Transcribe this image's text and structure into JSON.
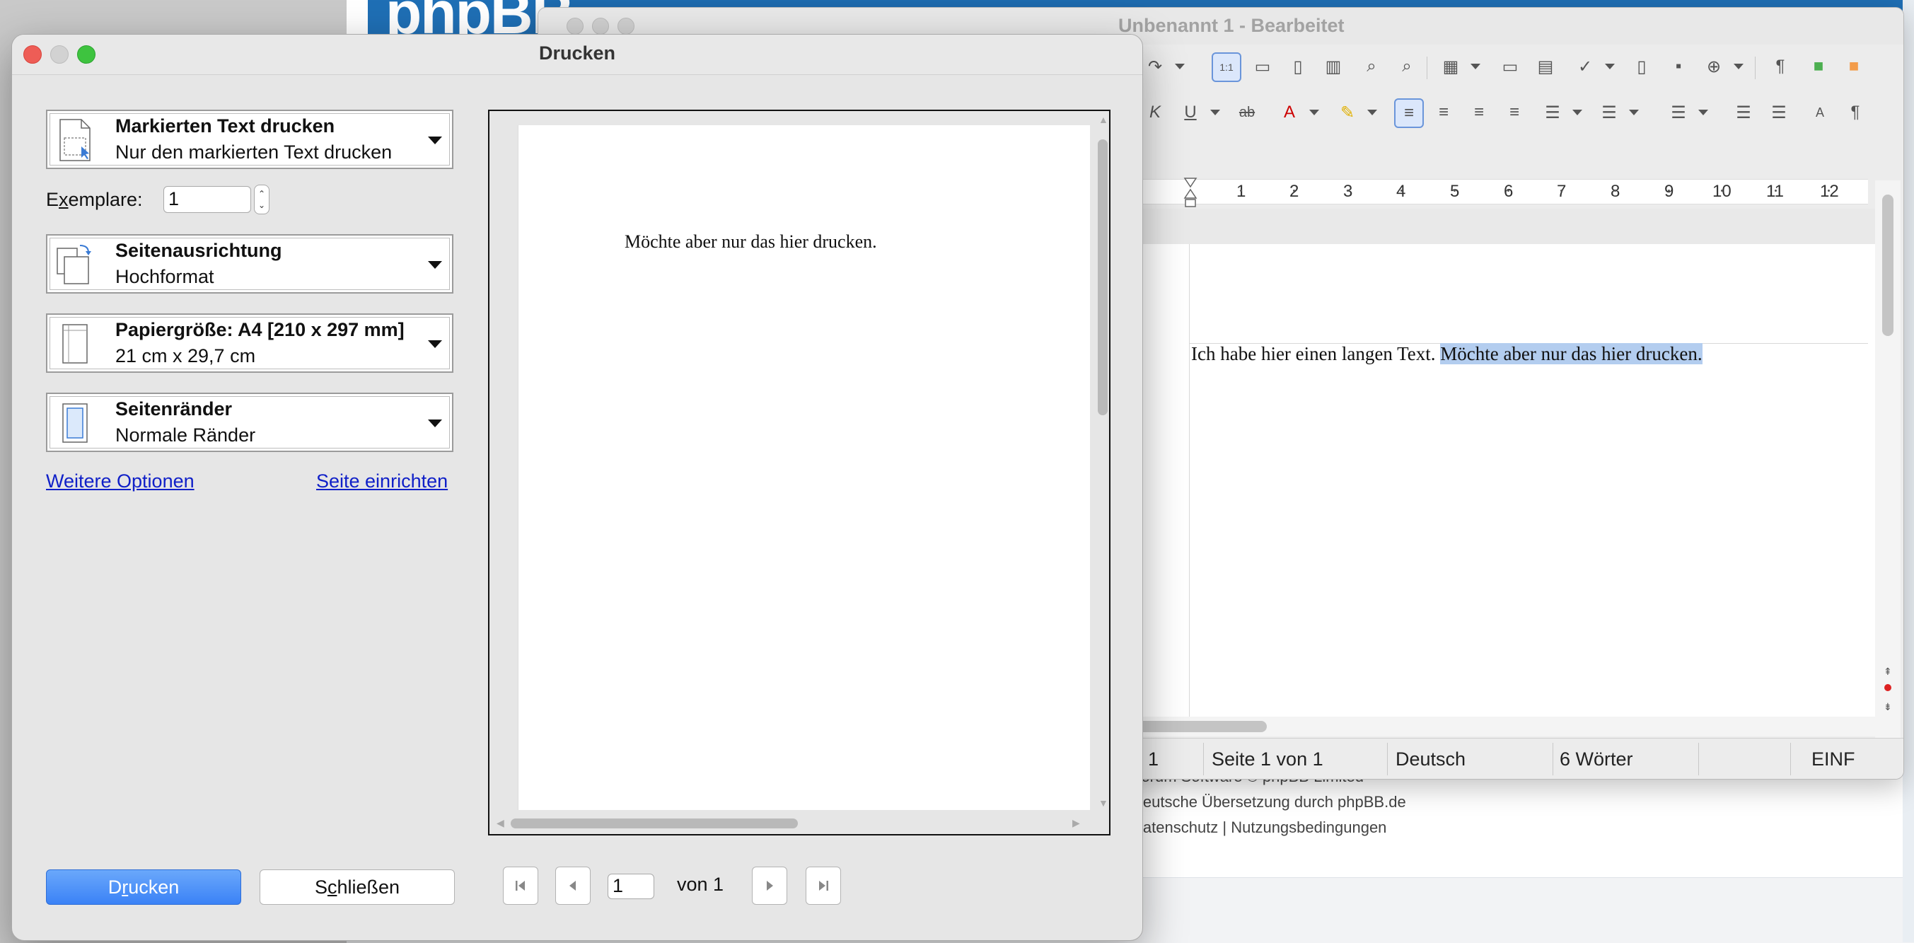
{
  "background": {
    "banner_text": "phpBB",
    "footer_lines": [
      "Forum Software © phpBB Limited",
      "Deutsche Übersetzung durch phpBB.de",
      "Datenschutz | Nutzungsbedingungen"
    ]
  },
  "writer": {
    "title": "Unbenannt 1 - Bearbeitet",
    "ruler_numbers": [
      "1",
      "2",
      "3",
      "4",
      "5",
      "6",
      "7",
      "8",
      "9",
      "10",
      "11",
      "12"
    ],
    "doc_text_plain": "Ich habe hier einen langen Text. ",
    "doc_text_selected": "Möchte aber nur das hier drucken.",
    "status": {
      "page_short": "1",
      "page_of": "Seite 1 von 1",
      "language": "Deutsch",
      "words": "6 Wörter",
      "mode": "EINF"
    }
  },
  "dialog": {
    "title": "Drucken",
    "range": {
      "title": "Markierten Text drucken",
      "subtitle": "Nur den markierten Text drucken"
    },
    "copies": {
      "label_pre": "E",
      "label_u": "x",
      "label_post": "emplare:",
      "value": "1"
    },
    "orientation": {
      "title": "Seitenausrichtung",
      "subtitle": "Hochformat"
    },
    "paper": {
      "title": "Papiergröße: A4 [210 x 297 mm]",
      "subtitle": "21 cm x 29,7 cm"
    },
    "margins": {
      "title": "Seitenränder",
      "subtitle": "Normale Ränder"
    },
    "links": {
      "more_options": "Weitere Optionen",
      "page_setup": "Seite einrichten"
    },
    "preview_text": "Möchte aber nur das hier drucken.",
    "buttons": {
      "print_pre": "D",
      "print_u": "r",
      "print_post": "ucken",
      "close_pre": "S",
      "close_u": "c",
      "close_post": "hließen"
    },
    "pager": {
      "current": "1",
      "of_label": "von 1"
    }
  },
  "colors": {
    "accent_blue": "#3b82f6",
    "selection": "#b3cdef",
    "link": "#1020c8",
    "close_red": "#ee5d56",
    "zoom_green": "#3ec33f"
  }
}
